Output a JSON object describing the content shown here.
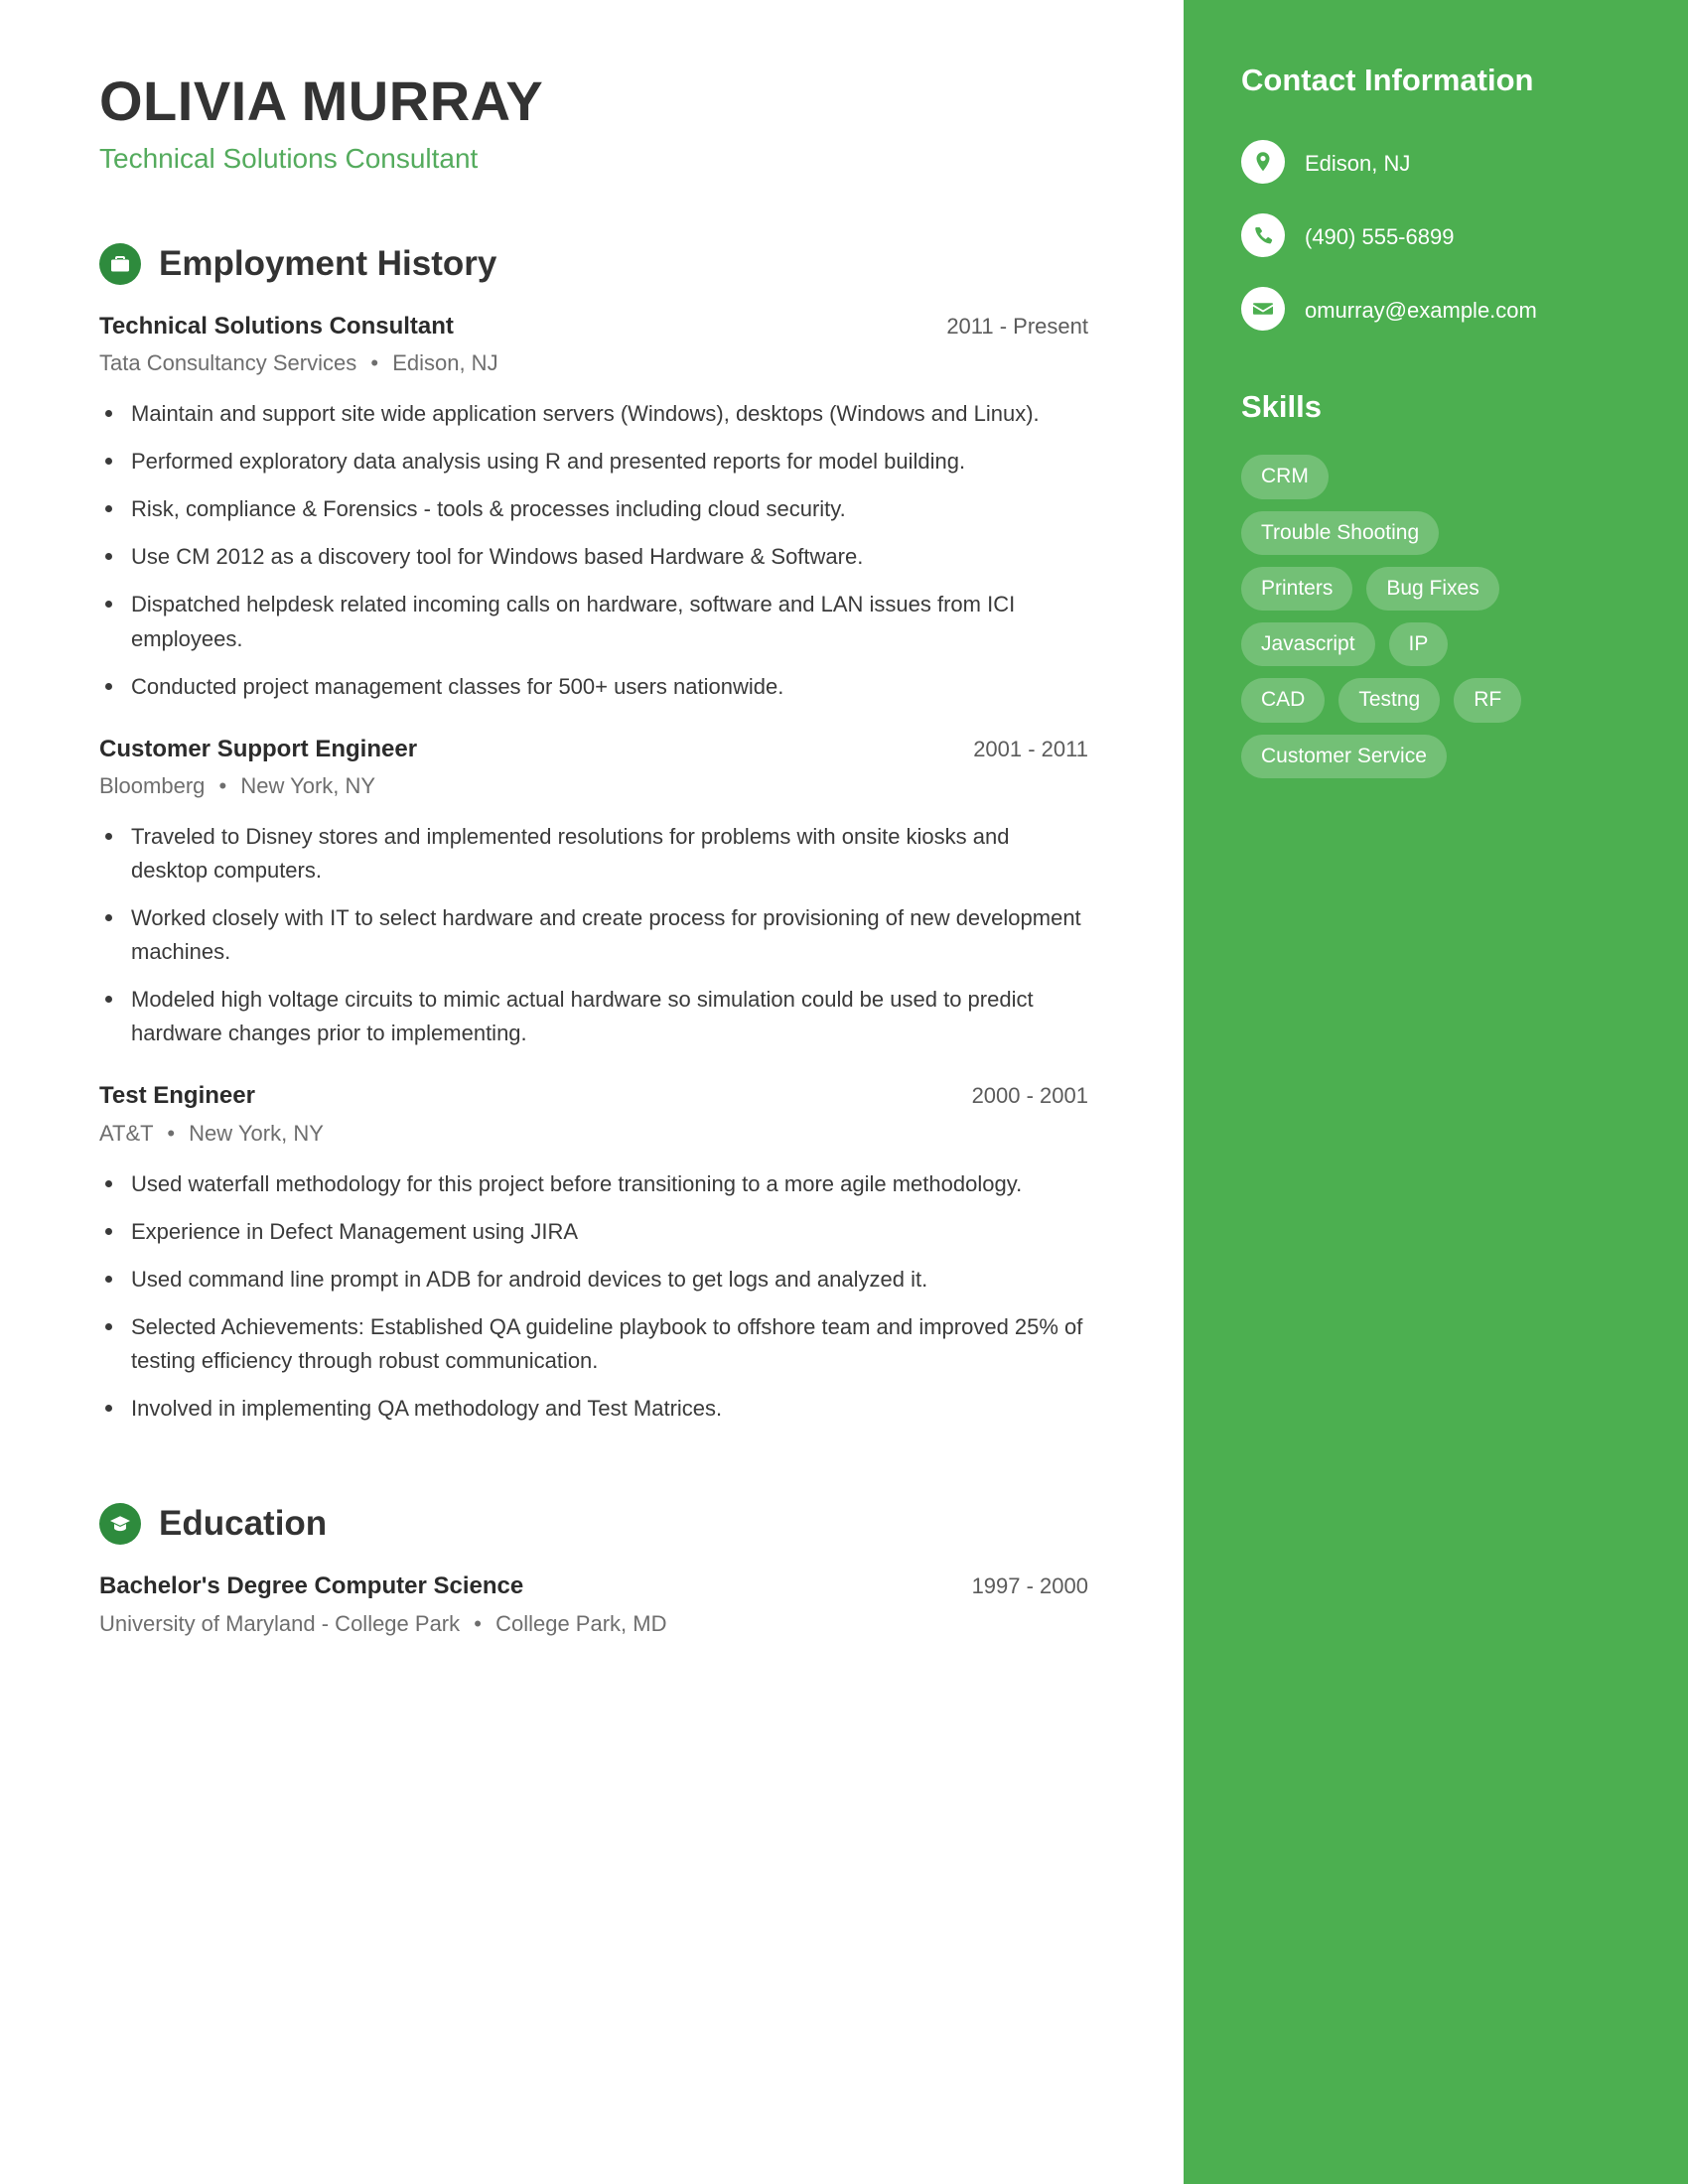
{
  "theme": {
    "sidebar_green": "#4CAF50",
    "icon_green": "#2E8B3D",
    "headline_green": "#54AB5D",
    "text_dark": "#333333"
  },
  "header": {
    "name": "OLIVIA MURRAY",
    "headline": "Technical Solutions Consultant"
  },
  "sections": {
    "employment": {
      "title": "Employment History",
      "icon": "briefcase-icon"
    },
    "education": {
      "title": "Education",
      "icon": "graduation-cap-icon"
    }
  },
  "employment_entries": [
    {
      "role": "Technical Solutions Consultant",
      "dates": "2011 - Present",
      "company": "Tata Consultancy Services",
      "location": "Edison, NJ",
      "bullets": [
        "Maintain and support site wide application servers (Windows), desktops (Windows and Linux).",
        "Performed exploratory data analysis using R and presented reports for model building.",
        "Risk, compliance & Forensics - tools & processes including cloud security.",
        "Use CM 2012 as a discovery tool for Windows based Hardware & Software.",
        "Dispatched helpdesk related incoming calls on hardware, software and LAN issues from ICI employees.",
        "Conducted project management classes for 500+ users nationwide."
      ]
    },
    {
      "role": "Customer Support Engineer",
      "dates": "2001 - 2011",
      "company": "Bloomberg",
      "location": "New York, NY",
      "bullets": [
        "Traveled to Disney stores and implemented resolutions for problems with onsite kiosks and desktop computers.",
        "Worked closely with IT to select hardware and create process for provisioning of new development machines.",
        "Modeled high voltage circuits to mimic actual hardware so simulation could be used to predict hardware changes prior to implementing."
      ]
    },
    {
      "role": "Test Engineer",
      "dates": "2000 - 2001",
      "company": "AT&T",
      "location": "New York, NY",
      "bullets": [
        "Used waterfall methodology for this project before transitioning to a more agile methodology.",
        "Experience in Defect Management using JIRA",
        "Used command line prompt in ADB for android devices to get logs and analyzed it.",
        "Selected Achievements: Established QA guideline playbook to offshore team and improved 25% of testing efficiency through robust communication.",
        "Involved in implementing QA methodology and Test Matrices."
      ]
    }
  ],
  "education_entries": [
    {
      "degree": "Bachelor's Degree Computer Science",
      "dates": "1997 - 2000",
      "school": "University of Maryland - College Park",
      "location": "College Park, MD"
    }
  ],
  "sidebar": {
    "contact_title": "Contact Information",
    "contacts": [
      {
        "icon": "location-pin-icon",
        "value": "Edison, NJ"
      },
      {
        "icon": "phone-icon",
        "value": "(490) 555-6899"
      },
      {
        "icon": "envelope-icon",
        "value": "omurray@example.com"
      }
    ],
    "skills_title": "Skills",
    "skills": [
      "CRM",
      "Trouble Shooting",
      "Printers",
      "Bug Fixes",
      "Javascript",
      "IP",
      "CAD",
      "Testng",
      "RF",
      "Customer Service"
    ]
  },
  "separator": "•"
}
